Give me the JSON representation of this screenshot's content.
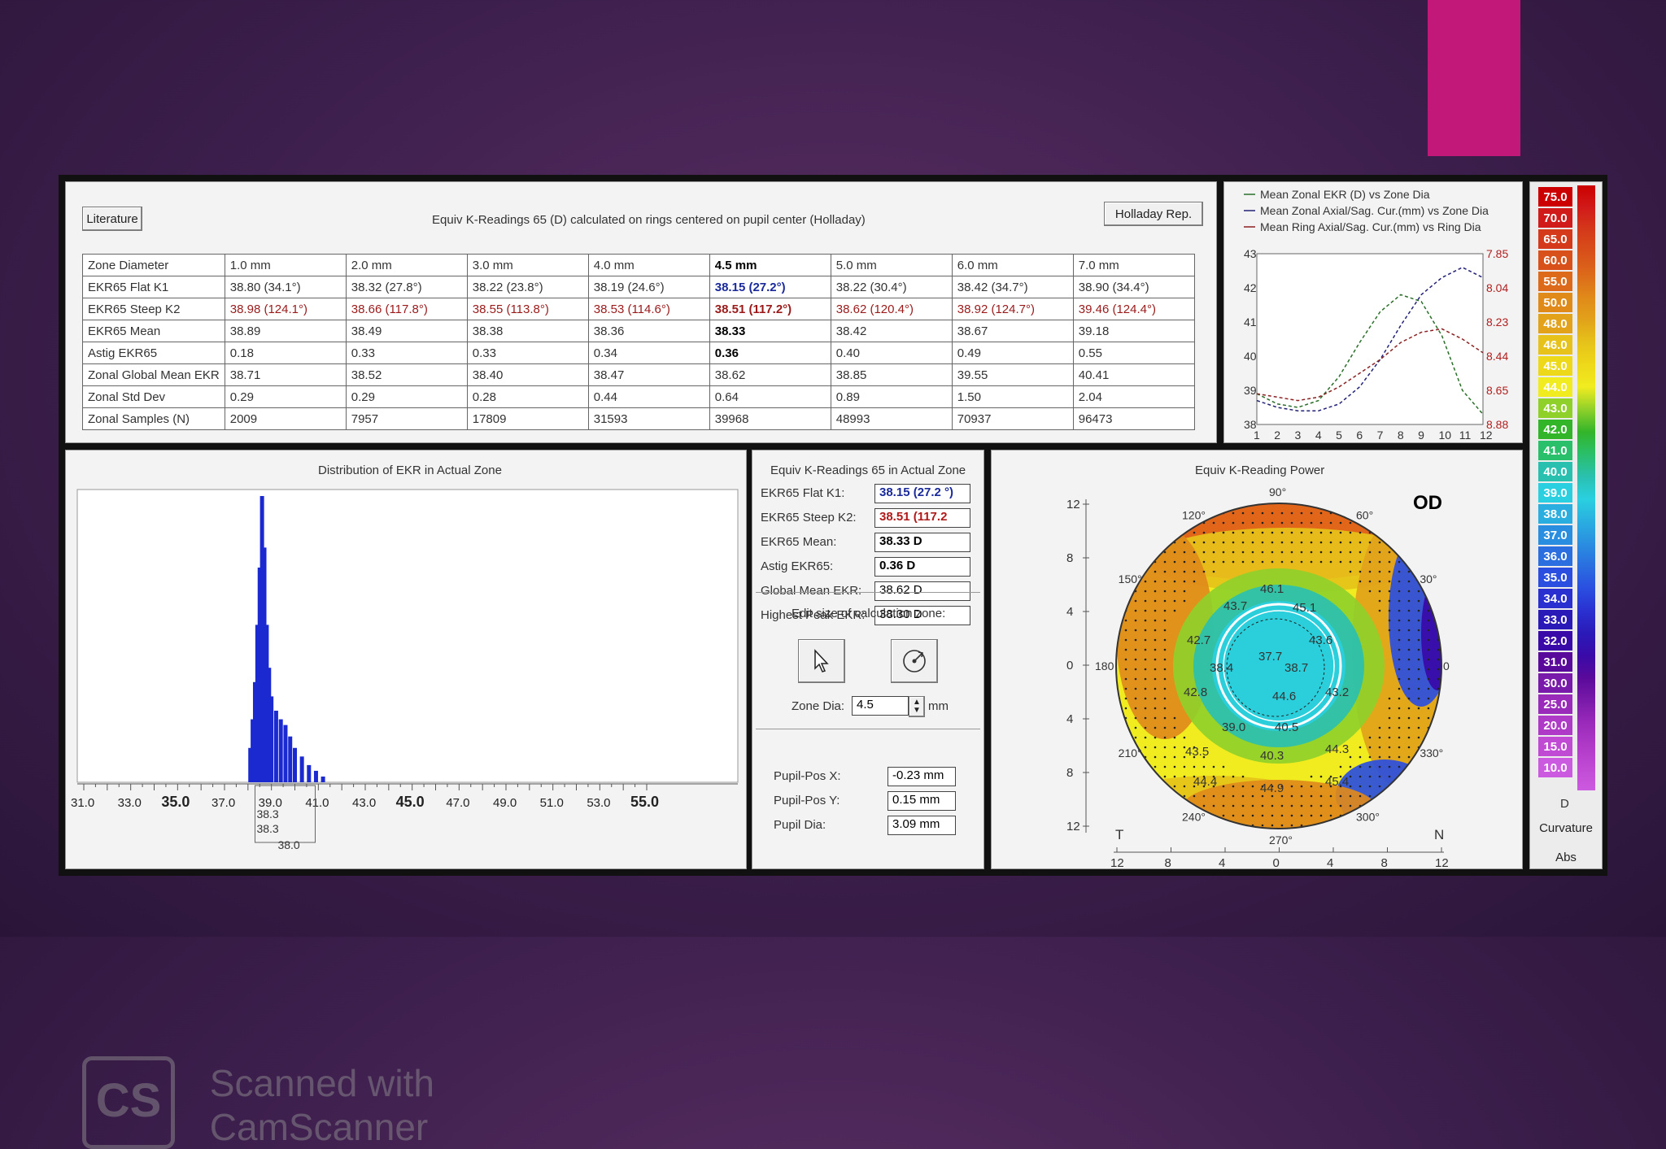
{
  "window": {
    "literature_btn": "Literature",
    "top_title": "Equiv K-Readings 65 (D) calculated on rings centered on pupil center (Holladay)",
    "holladay_btn": "Holladay Rep."
  },
  "table": {
    "headers": [
      "Zone Diameter",
      "1.0 mm",
      "2.0 mm",
      "3.0 mm",
      "4.0 mm",
      "4.5 mm",
      "5.0 mm",
      "6.0 mm",
      "7.0 mm"
    ],
    "rows": [
      {
        "label": "EKR65 Flat K1",
        "cells": [
          "38.80 (34.1°)",
          "38.32 (27.8°)",
          "38.22 (23.8°)",
          "38.19 (24.6°)",
          "38.15 (27.2°)",
          "38.22 (30.4°)",
          "38.42 (34.7°)",
          "38.90 (34.4°)"
        ]
      },
      {
        "label": "EKR65 Steep K2",
        "cells": [
          "38.98 (124.1°)",
          "38.66 (117.8°)",
          "38.55 (113.8°)",
          "38.53 (114.6°)",
          "38.51 (117.2°)",
          "38.62 (120.4°)",
          "38.92 (124.7°)",
          "39.46 (124.4°)"
        ]
      },
      {
        "label": "EKR65 Mean",
        "cells": [
          "38.89",
          "38.49",
          "38.38",
          "38.36",
          "38.33",
          "38.42",
          "38.67",
          "39.18"
        ]
      },
      {
        "label": "Astig EKR65",
        "cells": [
          "0.18",
          "0.33",
          "0.33",
          "0.34",
          "0.36",
          "0.40",
          "0.49",
          "0.55"
        ]
      },
      {
        "label": "Zonal Global Mean EKR",
        "cells": [
          "38.71",
          "38.52",
          "38.40",
          "38.47",
          "38.62",
          "38.85",
          "39.55",
          "40.41"
        ]
      },
      {
        "label": "Zonal Std Dev",
        "cells": [
          "0.29",
          "0.29",
          "0.28",
          "0.44",
          "0.64",
          "0.89",
          "1.50",
          "2.04"
        ]
      },
      {
        "label": "Zonal Samples (N)",
        "cells": [
          "2009",
          "7957",
          "17809",
          "31593",
          "39968",
          "48993",
          "70937",
          "96473"
        ]
      }
    ]
  },
  "legend": {
    "items": [
      "Mean Zonal EKR (D) vs Zone Dia",
      "Mean Zonal Axial/Sag. Cur.(mm) vs Zone Dia",
      "Mean Ring Axial/Sag. Cur.(mm) vs Ring Dia"
    ],
    "colors": [
      "#2a6e2a",
      "#222277",
      "#8a2222"
    ]
  },
  "chart_data": [
    {
      "type": "line",
      "x": [
        1,
        2,
        3,
        4,
        5,
        6,
        7,
        8,
        9,
        10,
        11,
        12
      ],
      "xlim": [
        1,
        12
      ],
      "ylim": [
        38,
        43
      ],
      "y2lim": [
        7.85,
        8.88
      ],
      "y_ticks": [
        38,
        39,
        40,
        41,
        42,
        43
      ],
      "y2_ticks": [
        "7.85",
        "8.04",
        "8.23",
        "8.44",
        "8.65",
        "8.88"
      ],
      "series": [
        {
          "name": "Mean Zonal EKR (D) vs Zone Dia",
          "color": "#2a6e2a",
          "values": [
            38.9,
            38.6,
            38.5,
            38.7,
            39.4,
            40.4,
            41.3,
            41.8,
            41.6,
            40.6,
            39.0,
            38.3
          ]
        },
        {
          "name": "Mean Zonal Axial/Sag. Cur.(mm) vs Zone Dia",
          "color": "#222277",
          "values": [
            38.7,
            38.5,
            38.4,
            38.4,
            38.6,
            39.1,
            39.9,
            40.9,
            41.8,
            42.3,
            42.6,
            42.3
          ]
        },
        {
          "name": "Mean Ring Axial/Sag. Cur.(mm) vs Ring Dia",
          "color": "#8a2222",
          "values": [
            38.9,
            38.8,
            38.7,
            38.8,
            39.1,
            39.5,
            39.9,
            40.4,
            40.7,
            40.8,
            40.5,
            40.1
          ]
        }
      ]
    },
    {
      "type": "bar",
      "title": "Distribution of EKR in Actual Zone",
      "x_ticks": [
        "31.0",
        "33.0",
        "35.0",
        "37.0",
        "39.0",
        "41.0",
        "43.0",
        "45.0",
        "47.0",
        "49.0",
        "51.0",
        "53.0",
        "55.0"
      ],
      "major_ticks": [
        "35.0",
        "45.0",
        "55.0"
      ],
      "xlim": [
        31,
        55
      ],
      "x": [
        38.1,
        38.2,
        38.3,
        38.4,
        38.5,
        38.6,
        38.7,
        38.8,
        38.9,
        39.0,
        39.2,
        39.4,
        39.6,
        39.8,
        40.0,
        40.3,
        40.6,
        40.9,
        41.2
      ],
      "values": [
        0.12,
        0.22,
        0.35,
        0.55,
        0.75,
        1.0,
        0.82,
        0.55,
        0.4,
        0.3,
        0.25,
        0.22,
        0.2,
        0.16,
        0.12,
        0.09,
        0.06,
        0.04,
        0.02
      ],
      "ylim": [
        0,
        1
      ]
    }
  ],
  "histogram": {
    "title": "Distribution of EKR in Actual Zone",
    "box_labels": [
      "38.3",
      "38.3",
      "38.0"
    ]
  },
  "summary": {
    "title": "Equiv K-Readings 65 in Actual Zone",
    "rows": [
      {
        "label": "EKR65 Flat K1:",
        "value": "38.15  (27.2 °)"
      },
      {
        "label": "EKR65 Steep K2:",
        "value": "38.51  (117.2"
      },
      {
        "label": "EKR65 Mean:",
        "value": "38.33 D"
      },
      {
        "label": "Astig EKR65:",
        "value": "0.36 D"
      },
      {
        "label": "Global Mean EKR:",
        "value": "38.62 D"
      },
      {
        "label": "Highest Peak EKR:",
        "value": "38.30 D"
      }
    ],
    "edit_label": "Edit size of calculation zone:",
    "zone_dia_label": "Zone Dia:",
    "zone_dia_value": "4.5",
    "zone_unit": "mm",
    "pupil": [
      {
        "label": "Pupil-Pos X:",
        "value": "-0.23 mm"
      },
      {
        "label": "Pupil-Pos Y:",
        "value": "0.15 mm"
      },
      {
        "label": "Pupil Dia:",
        "value": "3.09 mm"
      }
    ]
  },
  "map": {
    "title": "Equiv K-Reading Power",
    "eye": "OD",
    "angles": [
      "90°",
      "60°",
      "30°",
      "0",
      "330°",
      "300°",
      "270°",
      "240°",
      "210°",
      "180",
      "150°",
      "120°"
    ],
    "values": [
      "46.1",
      "43.7",
      "45.1",
      "42.7",
      "43.6",
      "37.7",
      "38.4",
      "38.7",
      "42.8",
      "44.6",
      "43.2",
      "39.0",
      "40.5",
      "43.5",
      "44.3",
      "40.3",
      "44.4",
      "44.9",
      "45.4"
    ],
    "y_axis": [
      "12",
      "8",
      "4",
      "0",
      "4",
      "8",
      "12"
    ],
    "x_axis": [
      "12",
      "8",
      "4",
      "0",
      "4",
      "8",
      "12"
    ],
    "t_label": "T",
    "n_label": "N"
  },
  "scale": {
    "values": [
      "75.0",
      "70.0",
      "65.0",
      "60.0",
      "55.0",
      "50.0",
      "48.0",
      "46.0",
      "45.0",
      "44.0",
      "43.0",
      "42.0",
      "41.0",
      "40.0",
      "39.0",
      "38.0",
      "37.0",
      "36.0",
      "35.0",
      "34.0",
      "33.0",
      "32.0",
      "31.0",
      "30.0",
      "25.0",
      "20.0",
      "15.0",
      "10.0"
    ],
    "colors": [
      "#cc0000",
      "#d11a1a",
      "#d43a1a",
      "#d8501a",
      "#dc6a1a",
      "#e08a1a",
      "#e2a21a",
      "#e6c21a",
      "#eed81a",
      "#f0ec20",
      "#8fd02a",
      "#33b52a",
      "#2abf6a",
      "#2ac0b0",
      "#2ad0e0",
      "#2aaee0",
      "#2a8ee0",
      "#2a6ee0",
      "#2a4ee0",
      "#2a30d0",
      "#2a1ab8",
      "#3a0aa8",
      "#5a0a9a",
      "#7a1aaa",
      "#9a2aba",
      "#b03ac8",
      "#c04ad4",
      "#cc5ae0"
    ],
    "unit_d": "D",
    "curvature": "Curvature",
    "abs": "Abs"
  },
  "watermark": {
    "logo": "CS",
    "line1": "Scanned with",
    "line2": "CamScanner"
  }
}
